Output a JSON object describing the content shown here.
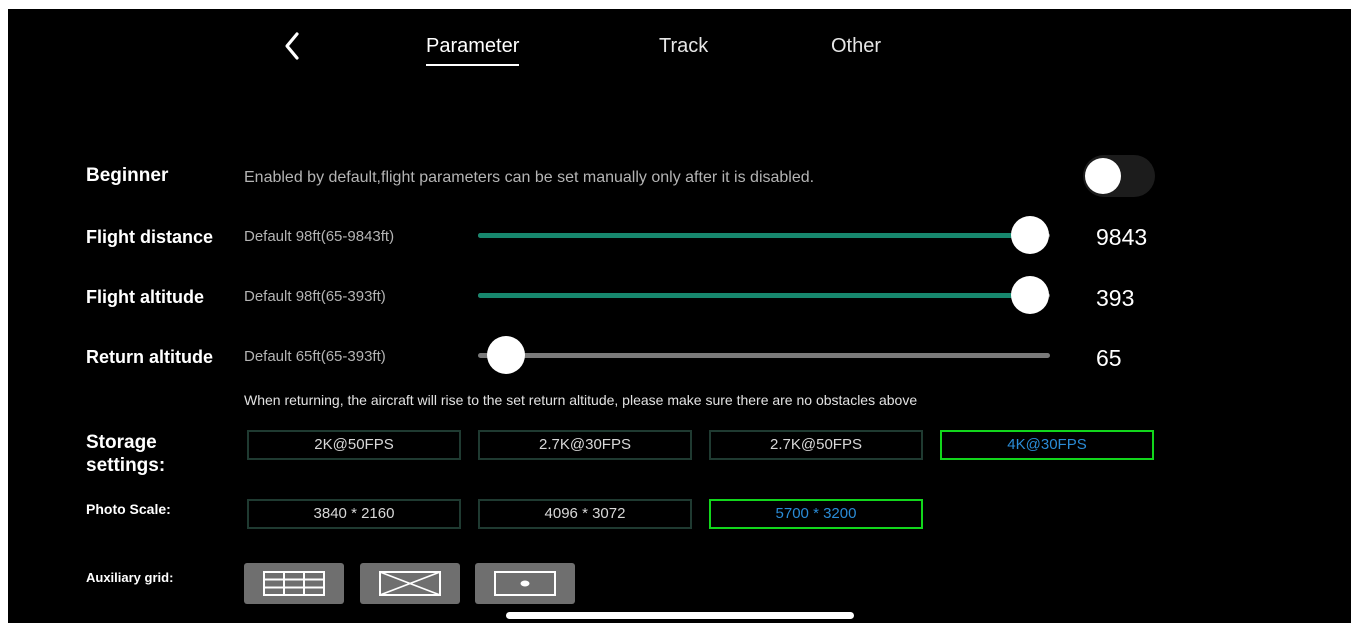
{
  "nav": {
    "back_icon": "chevron-left-icon",
    "tabs": [
      {
        "label": "Parameter",
        "active": true
      },
      {
        "label": "Track",
        "active": false
      },
      {
        "label": "Other",
        "active": false
      }
    ]
  },
  "beginner": {
    "label": "Beginner",
    "description": "Enabled by default,flight parameters can be set manually only after it is disabled.",
    "enabled": false
  },
  "flight_distance": {
    "label": "Flight distance",
    "description": "Default 98ft(65-9843ft)",
    "value": "9843",
    "min": 65,
    "max": 9843,
    "current": 9843
  },
  "flight_altitude": {
    "label": "Flight altitude",
    "description": "Default 98ft(65-393ft)",
    "value": "393",
    "min": 65,
    "max": 393,
    "current": 393
  },
  "return_altitude": {
    "label": "Return altitude",
    "description": "Default 65ft(65-393ft)",
    "value": "65",
    "min": 65,
    "max": 393,
    "current": 65,
    "note": "When returning, the aircraft will rise to the set return altitude, please make sure there are no obstacles above"
  },
  "storage": {
    "label_line1": "Storage",
    "label_line2": "settings:",
    "options": [
      "2K@50FPS",
      "2.7K@30FPS",
      "2.7K@50FPS",
      "4K@30FPS"
    ],
    "selected": "4K@30FPS"
  },
  "photo_scale": {
    "label": "Photo Scale:",
    "options": [
      "3840 * 2160",
      "4096 * 3072",
      "5700 * 3200"
    ],
    "selected": "5700 * 3200"
  },
  "auxiliary_grid": {
    "label": "Auxiliary grid:",
    "options": [
      "grid-3x3-icon",
      "grid-diagonal-icon",
      "grid-center-dot-icon"
    ]
  },
  "colors": {
    "accent_track": "#17876d",
    "selected_border": "#12d61c",
    "selected_text": "#2a8bd6"
  }
}
